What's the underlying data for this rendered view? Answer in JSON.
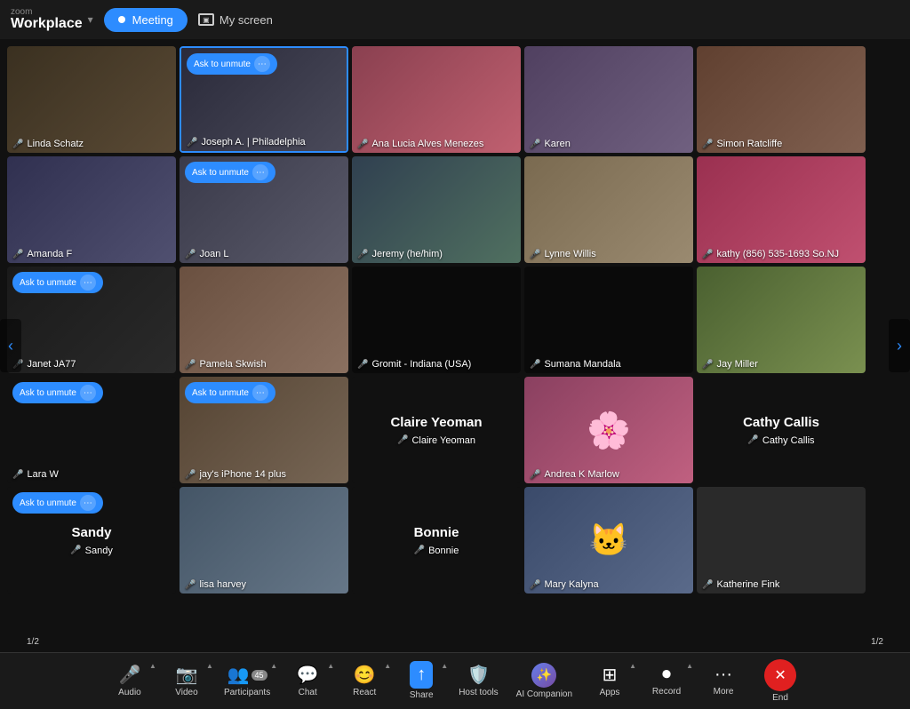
{
  "app": {
    "name": "zoom",
    "product": "Workplace"
  },
  "topbar": {
    "meeting_label": "Meeting",
    "screen_label": "My screen",
    "dropdown_arrow": "▾"
  },
  "participants": [
    {
      "id": "linda",
      "name": "Linda Schatz",
      "muted": true,
      "ask_unmute": false,
      "bg": "bg-room1",
      "row": 1,
      "col": 1
    },
    {
      "id": "joseph",
      "name": "Joseph A. | Philadelphia",
      "muted": false,
      "ask_unmute": true,
      "bg": "bg-room2",
      "row": 1,
      "col": 2,
      "highlighted": true
    },
    {
      "id": "ana",
      "name": "Ana Lucia Alves Menezes",
      "muted": true,
      "ask_unmute": false,
      "bg": "bg-pink",
      "row": 1,
      "col": 3
    },
    {
      "id": "karen",
      "name": "Karen",
      "muted": true,
      "ask_unmute": false,
      "bg": "bg-room3",
      "row": 1,
      "col": 4
    },
    {
      "id": "simon",
      "name": "Simon Ratcliffe",
      "muted": true,
      "ask_unmute": false,
      "bg": "bg-warm",
      "row": 1,
      "col": 5
    },
    {
      "id": "amanda",
      "name": "Amanda F",
      "muted": true,
      "ask_unmute": false,
      "bg": "bg-blue-room",
      "row": 2,
      "col": 1
    },
    {
      "id": "joan",
      "name": "Joan L",
      "muted": true,
      "ask_unmute": true,
      "bg": "bg-room2",
      "row": 2,
      "col": 2
    },
    {
      "id": "jeremy",
      "name": "Jeremy (he/him)",
      "muted": true,
      "ask_unmute": false,
      "bg": "bg-green",
      "row": 2,
      "col": 3
    },
    {
      "id": "lynne",
      "name": "Lynne Willis",
      "muted": true,
      "ask_unmute": false,
      "bg": "bg-beige",
      "row": 2,
      "col": 4
    },
    {
      "id": "kathy",
      "name": "kathy (856) 535-1693 So.NJ",
      "muted": true,
      "ask_unmute": false,
      "bg": "bg-pink",
      "row": 2,
      "col": 5
    },
    {
      "id": "janet",
      "name": "Janet JA77",
      "muted": true,
      "ask_unmute": true,
      "bg": "bg-room1",
      "row": 3,
      "col": 1
    },
    {
      "id": "pamela",
      "name": "Pamela Skwish",
      "muted": true,
      "ask_unmute": false,
      "bg": "bg-warm",
      "row": 3,
      "col": 2
    },
    {
      "id": "gromit",
      "name": "Gromit - Indiana (USA)",
      "muted": true,
      "ask_unmute": false,
      "bg": "bg-dark",
      "row": 3,
      "col": 3
    },
    {
      "id": "sumana",
      "name": "Sumana Mandala",
      "muted": true,
      "ask_unmute": false,
      "bg": "bg-dark",
      "row": 3,
      "col": 4
    },
    {
      "id": "jay",
      "name": "Jay Miller",
      "muted": true,
      "ask_unmute": false,
      "bg": "bg-outdoor",
      "row": 3,
      "col": 5
    },
    {
      "id": "lara",
      "name": "Lara W",
      "muted": true,
      "ask_unmute": true,
      "bg": "bg-dark",
      "row": 4,
      "col": 1
    },
    {
      "id": "jayiphone",
      "name": "jay's iPhone 14 plus",
      "muted": true,
      "ask_unmute": true,
      "bg": "bg-person1",
      "row": 4,
      "col": 2
    },
    {
      "id": "claire_label",
      "name": "Claire Yeoman",
      "muted": true,
      "ask_unmute": false,
      "bg": "bg-dark",
      "row": 4,
      "col": 3,
      "display_name": "Claire Yeoman"
    },
    {
      "id": "andrea",
      "name": "Andrea K Marlow",
      "muted": true,
      "ask_unmute": false,
      "bg": "bg-pink",
      "row": 4,
      "col": 4
    },
    {
      "id": "cathy_label",
      "name": "Cathy Callis",
      "muted": true,
      "ask_unmute": false,
      "bg": "bg-dark",
      "row": 4,
      "col": 5,
      "display_name": "Cathy Callis"
    },
    {
      "id": "sandy_label",
      "name": "Sandy",
      "muted": true,
      "ask_unmute": true,
      "bg": "bg-dark",
      "row": 5,
      "col": 1,
      "display_name": "Sandy"
    },
    {
      "id": "lisa",
      "name": "lisa harvey",
      "muted": true,
      "ask_unmute": false,
      "bg": "bg-person2",
      "row": 5,
      "col": 2
    },
    {
      "id": "bonnie_label",
      "name": "Bonnie",
      "muted": true,
      "ask_unmute": false,
      "bg": "bg-dark",
      "row": 5,
      "col": 3,
      "display_name": "Bonnie"
    },
    {
      "id": "mary",
      "name": "Mary Kalyna",
      "muted": true,
      "ask_unmute": false,
      "bg": "bg-room2",
      "row": 5,
      "col": 4
    },
    {
      "id": "katherine",
      "name": "Katherine Fink",
      "muted": true,
      "ask_unmute": false,
      "bg": "bg-warm",
      "row": 5,
      "col": 5
    }
  ],
  "page": {
    "current": "1",
    "total": "2",
    "label": "1/2"
  },
  "toolbar": {
    "audio_label": "Audio",
    "video_label": "Video",
    "participants_label": "Participants",
    "participants_count": "45",
    "chat_label": "Chat",
    "react_label": "React",
    "share_label": "Share",
    "host_tools_label": "Host tools",
    "ai_companion_label": "AI Companion",
    "apps_label": "Apps",
    "record_label": "Record",
    "more_label": "More",
    "end_label": "End"
  },
  "ask_unmute_label": "Ask to unmute",
  "colors": {
    "accent": "#2d8cff",
    "end_red": "#e02020",
    "toolbar_bg": "#1a1a1a",
    "video_bg": "#111"
  }
}
